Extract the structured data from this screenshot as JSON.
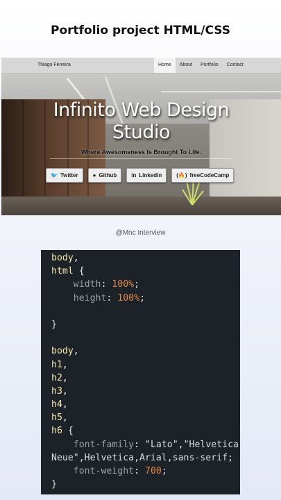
{
  "heading": "Portfolio project HTML/CSS",
  "site": {
    "brand": "Thiago Ferreira",
    "nav": [
      "Home",
      "About",
      "Portfolio",
      "Contact"
    ],
    "active_nav": "Home",
    "title_line1": "Infinito Web Design",
    "title_line2": "Studio",
    "subtitle": "Where Awesomeness Is Brought To Life.",
    "buttons": [
      {
        "label": "Twitter",
        "icon": "twitter-icon"
      },
      {
        "label": "Github",
        "icon": "github-icon"
      },
      {
        "label": "Linkedin",
        "icon": "linkedin-icon"
      },
      {
        "label": "freeCodeCamp",
        "icon": "freecodecamp-icon"
      }
    ]
  },
  "credit": "@Mnc Interview",
  "code_lines": [
    "body,",
    "html {",
    "    width: 100%;",
    "    height: 100%;",
    "",
    "}",
    "",
    "body,",
    "h1,",
    "h2,",
    "h3,",
    "h4,",
    "h5,",
    "h6 {",
    "    font-family: \"Lato\",\"Helvetica",
    "Neue\",Helvetica,Arial,sans-serif;",
    "    font-weight: 700;",
    "}"
  ],
  "colors": {
    "code_bg": "#1d2229",
    "selector": "#f6e9b0",
    "number": "#e0884a",
    "property": "#9aa0a6"
  }
}
